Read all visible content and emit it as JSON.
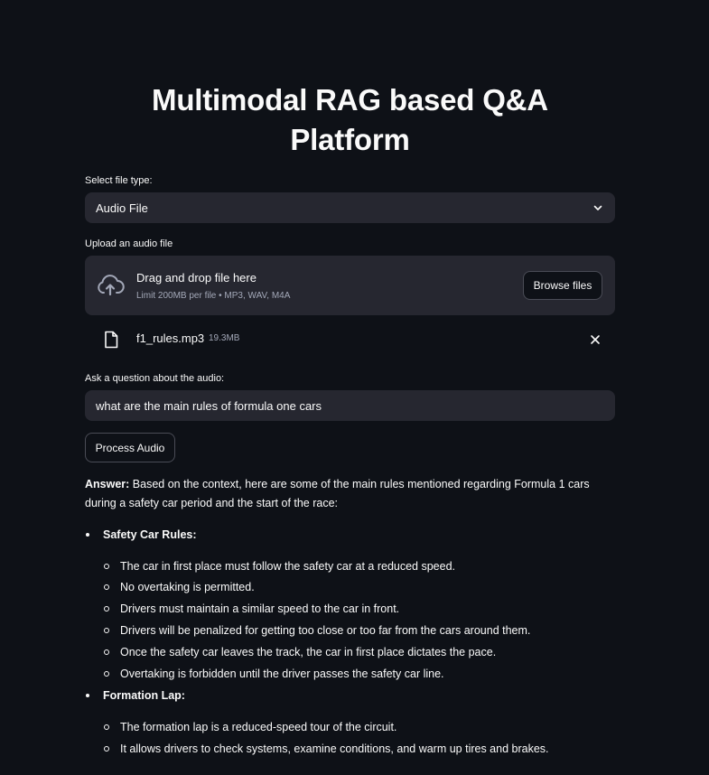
{
  "title": "Multimodal RAG based Q&A Platform",
  "file_type": {
    "label": "Select file type:",
    "selected": "Audio File",
    "icon": "chevron-down-icon"
  },
  "uploader": {
    "label": "Upload an audio file",
    "drag_text": "Drag and drop file here",
    "limit_text": "Limit 200MB per file • MP3, WAV, M4A",
    "browse_label": "Browse files",
    "icon": "cloud-upload-icon"
  },
  "uploaded_file": {
    "name": "f1_rules.mp3",
    "size": "19.3MB",
    "icon": "file-icon",
    "remove_icon": "close-icon"
  },
  "question": {
    "label": "Ask a question about the audio:",
    "value": "what are the main rules of formula one cars"
  },
  "process_button": "Process Audio",
  "answer": {
    "prefix": "Answer:",
    "text": " Based on the context, here are some of the main rules mentioned regarding Formula 1 cars during a safety car period and the start of the race:",
    "sections": [
      {
        "heading": "Safety Car Rules:",
        "items": [
          "The car in first place must follow the safety car at a reduced speed.",
          "No overtaking is permitted.",
          "Drivers must maintain a similar speed to the car in front.",
          "Drivers will be penalized for getting too close or too far from the cars around them.",
          "Once the safety car leaves the track, the car in first place dictates the pace.",
          "Overtaking is forbidden until the driver passes the safety car line."
        ]
      },
      {
        "heading": "Formation Lap:",
        "items": [
          "The formation lap is a reduced-speed tour of the circuit.",
          "It allows drivers to check systems, examine conditions, and warm up tires and brakes."
        ]
      }
    ]
  },
  "colors": {
    "background": "#0e1117",
    "surface": "#262730",
    "text": "#fafafa",
    "muted": "#a3a8b8"
  }
}
